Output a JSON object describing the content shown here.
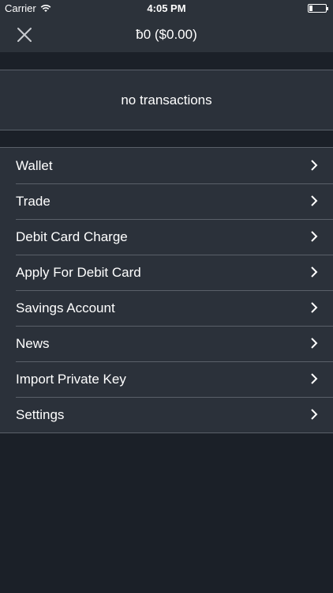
{
  "status_bar": {
    "carrier": "Carrier",
    "time": "4:05 PM",
    "battery_level": 0.2
  },
  "nav": {
    "title": "ƀ0 ($0.00)",
    "close_icon": "close-icon"
  },
  "summary": {
    "text": "no transactions"
  },
  "menu": {
    "items": [
      {
        "label": "Wallet"
      },
      {
        "label": "Trade"
      },
      {
        "label": "Debit Card Charge"
      },
      {
        "label": "Apply For Debit Card"
      },
      {
        "label": "Savings Account"
      },
      {
        "label": "News"
      },
      {
        "label": "Import Private Key"
      },
      {
        "label": "Settings"
      }
    ]
  },
  "colors": {
    "background": "#1b2028",
    "bar": "#2c323a",
    "cell": "#2b313a",
    "separator": "#5a6069",
    "text": "#ffffff"
  }
}
